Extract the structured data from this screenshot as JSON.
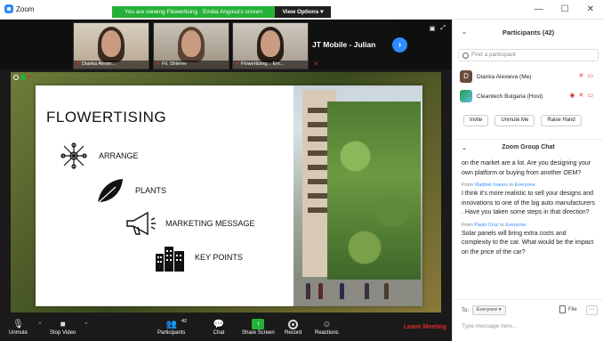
{
  "window": {
    "app_title": "Zoom",
    "viewing_banner": "You are viewing Flowertising · Emilia Angova's screen",
    "view_options": "View Options ▾",
    "controls": [
      "—",
      "☐",
      "✕"
    ]
  },
  "thumbnails": [
    {
      "name": "Dianka Alexie..."
    },
    {
      "name": "Fil. Shterev"
    },
    {
      "name": "Flowertising... Em..."
    }
  ],
  "jt_tile": {
    "name": "JT Mobile - Julian",
    "next_icon": "›"
  },
  "slide": {
    "title": "FLOWERTISING",
    "items": [
      {
        "label": "ARRANGE",
        "icon": "arrange-icon"
      },
      {
        "label": "PLANTS",
        "icon": "leaf-icon"
      },
      {
        "label": "MARKETING MESSAGE",
        "icon": "megaphone-icon"
      },
      {
        "label": "KEY POINTS",
        "icon": "buildings-icon"
      }
    ]
  },
  "toolbar": {
    "unmute": "Unmute",
    "stop_video": "Stop Video",
    "participants": "Participants",
    "participants_count": "42",
    "chat": "Chat",
    "share_screen": "Share Screen",
    "record": "Record",
    "reactions": "Reactions",
    "leave": "Leave Meeting"
  },
  "participants_panel": {
    "title": "Participants (42)",
    "search_placeholder": "Find a participant",
    "rows": [
      {
        "avatar": "D",
        "name": "Dianka Alexieva (Me)"
      },
      {
        "avatar": "",
        "name": "Cleantech Bulgaria (Host)"
      }
    ],
    "buttons": [
      "Invite",
      "Unmute Me",
      "Raise Hand"
    ]
  },
  "chat": {
    "title": "Zoom Group Chat",
    "messages": [
      {
        "from": "",
        "to": "",
        "text": "on the market are a lot. Are you designing your own platform or buying from another OEM?"
      },
      {
        "from": "Vladimir Ivanov",
        "to": "Everyone",
        "text": "I think it's more realistic to sell your designs and innovations to one of the big auto manufacturers . Have you taken some steps in that direction?"
      },
      {
        "from": "Paulo Cruz",
        "to": "Everyone",
        "text": "Solar panels will bring extra costs and complexity to the car. What would be the impact on the price of the car?"
      }
    ],
    "from_word": "From",
    "to_word": "to",
    "to_label": "To:",
    "to_value": "Everyone ▾",
    "file_label": "File",
    "more_label": "···",
    "input_placeholder": "Type message here..."
  }
}
